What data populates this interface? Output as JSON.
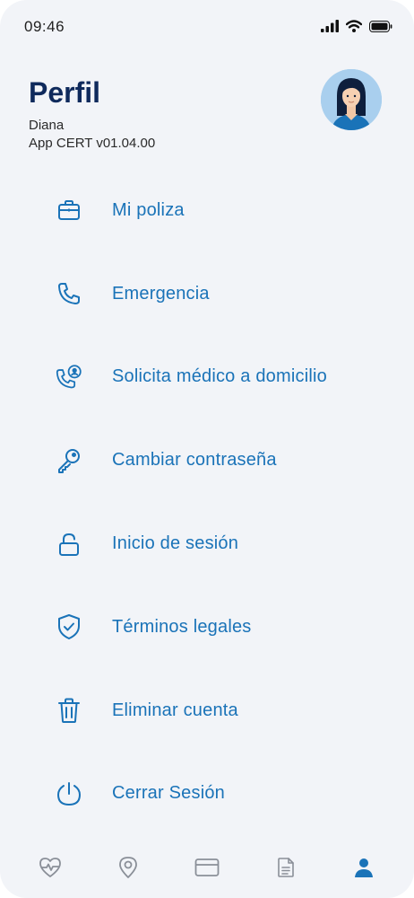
{
  "status_bar": {
    "time": "09:46",
    "icons": [
      "signal-icon",
      "wifi-icon",
      "battery-icon"
    ]
  },
  "header": {
    "title": "Perfil",
    "user_name": "Diana",
    "app_version": "App CERT v01.04.00"
  },
  "menu": {
    "items": [
      {
        "label": "Mi poliza",
        "icon": "briefcase-icon"
      },
      {
        "label": "Emergencia",
        "icon": "phone-icon"
      },
      {
        "label": "Solicita médico a domicilio",
        "icon": "phone-doctor-icon"
      },
      {
        "label": "Cambiar contraseña",
        "icon": "key-icon"
      },
      {
        "label": "Inicio de sesión",
        "icon": "unlock-icon"
      },
      {
        "label": "Términos legales",
        "icon": "shield-check-icon"
      },
      {
        "label": "Eliminar cuenta",
        "icon": "trash-icon"
      },
      {
        "label": "Cerrar Sesión",
        "icon": "power-icon"
      }
    ]
  },
  "bottom_nav": {
    "items": [
      {
        "icon": "heart-pulse-icon",
        "active": false
      },
      {
        "icon": "location-pin-icon",
        "active": false
      },
      {
        "icon": "card-icon",
        "active": false
      },
      {
        "icon": "document-icon",
        "active": false
      },
      {
        "icon": "profile-icon",
        "active": true
      }
    ]
  },
  "colors": {
    "background": "#f2f4f8",
    "title": "#0f2a5c",
    "accent": "#1a73b8",
    "nav_inactive": "#8a8f98",
    "avatar_bg": "#a9cfee"
  }
}
